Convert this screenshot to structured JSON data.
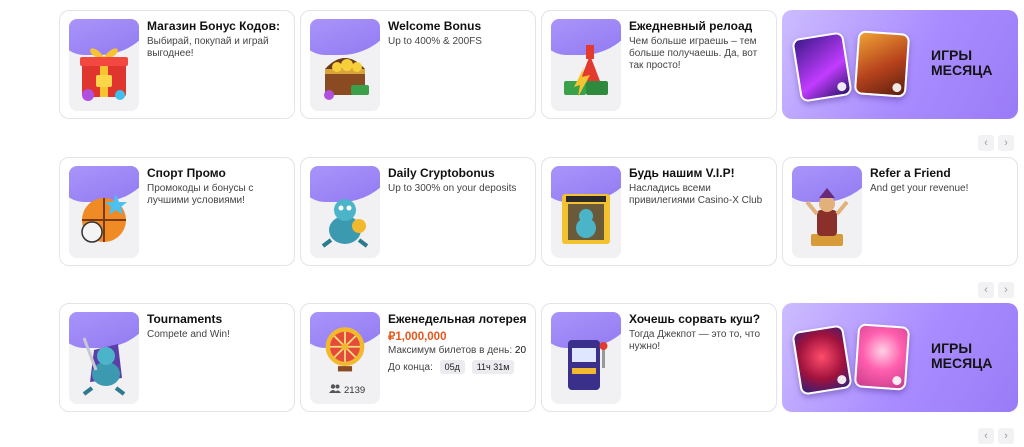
{
  "rows": [
    {
      "cards": [
        {
          "title": "Магазин Бонус Кодов:",
          "desc": "Выбирай, покупай и играй выгоднее!",
          "icon": "gift-box-icon"
        },
        {
          "title": "Welcome Bonus",
          "desc": "Up to 400% & 200FS",
          "icon": "treasure-chest-icon"
        },
        {
          "title": "Ежедневный релоад",
          "desc": "Чем больше играешь – тем больше получаешь. Да, вот так просто!",
          "icon": "reload-arrow-icon"
        }
      ],
      "promo": {
        "title": "ИГРЫ МЕСЯЦА",
        "games": [
          "game-tile-1",
          "game-tile-2"
        ]
      }
    },
    {
      "cards": [
        {
          "title": "Спорт Промо",
          "desc": "Промокоды и бонусы с лучшими условиями!",
          "icon": "sports-ball-icon"
        },
        {
          "title": "Daily Cryptobonus",
          "desc": "Up to 300% on your deposits",
          "icon": "crypto-dragon-icon"
        },
        {
          "title": "Будь нашим V.I.P!",
          "desc": "Насладись всеми привилегиями Casino-X Club",
          "icon": "vip-booth-icon"
        },
        {
          "title": "Refer a Friend",
          "desc": "And get your revenue!",
          "icon": "friend-character-icon"
        }
      ]
    },
    {
      "cards": [
        {
          "title": "Tournaments",
          "desc": "Compete and Win!",
          "icon": "knight-dragon-icon"
        },
        {
          "title": "Еженедельная лотерея",
          "prize": "₽1,000,000",
          "max_label": "Максимум билетов в день:",
          "max_value": "20",
          "end_label": "До конца:",
          "days": "05д",
          "time": "11ч 31м",
          "players": "2139",
          "icon": "lottery-wheel-icon"
        },
        {
          "title": "Хочешь сорвать куш?",
          "desc": "Тогда Джекпот — это то, что нужно!",
          "icon": "slot-machine-icon"
        }
      ],
      "promo": {
        "title": "ИГРЫ МЕСЯЦА",
        "games": [
          "game-tile-3",
          "game-tile-4"
        ]
      }
    }
  ],
  "nav": {
    "prev": "‹",
    "next": "›"
  },
  "colors": {
    "accent": "#9a7bf7",
    "prize": "#e4561c"
  }
}
